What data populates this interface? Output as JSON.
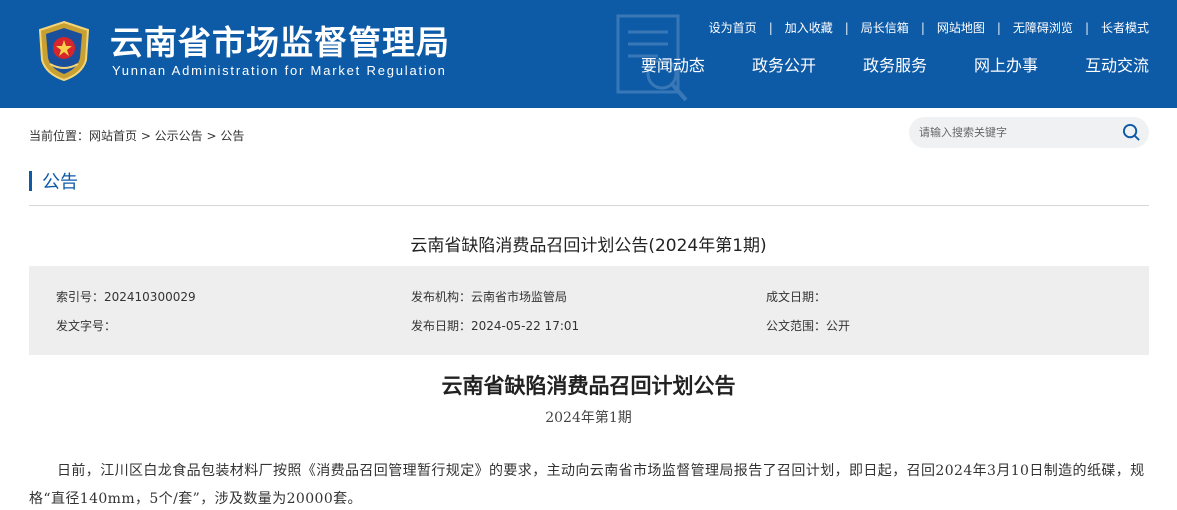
{
  "header": {
    "title": "云南省市场监督管理局",
    "subtitle": "Yunnan Administration for Market Regulation",
    "brand_color": "#0d5aa7",
    "toplinks": [
      "设为首页",
      "加入收藏",
      "局长信箱",
      "网站地图",
      "无障碍浏览",
      "长者模式"
    ],
    "nav": [
      "要闻动态",
      "政务公开",
      "政务服务",
      "网上办事",
      "互动交流"
    ]
  },
  "breadcrumb": "当前位置：网站首页 > 公示公告 > 公告",
  "search": {
    "placeholder": "请输入搜索关键字"
  },
  "section": {
    "title": "公告"
  },
  "article": {
    "title": "云南省缺陷消费品召回计划公告(2024年第1期)"
  },
  "meta": {
    "index_no": "索引号：202410300029",
    "doc_no": "发文字号：",
    "publisher": "发布机构：云南省市场监管局",
    "publish_date": "发布日期：2024-05-22 17:01",
    "created_date": "成文日期：",
    "scope": "公文范围：公开"
  },
  "body": {
    "heading": "云南省缺陷消费品召回计划公告",
    "issue": "2024年第1期",
    "paragraph": "日前，江川区白龙食品包装材料厂按照《消费品召回管理暂行规定》的要求，主动向云南省市场监督管理局报告了召回计划，即日起，召回2024年3月10日制造的纸碟，规格“直径140mm，5个/套”，涉及数量为20000套。"
  }
}
